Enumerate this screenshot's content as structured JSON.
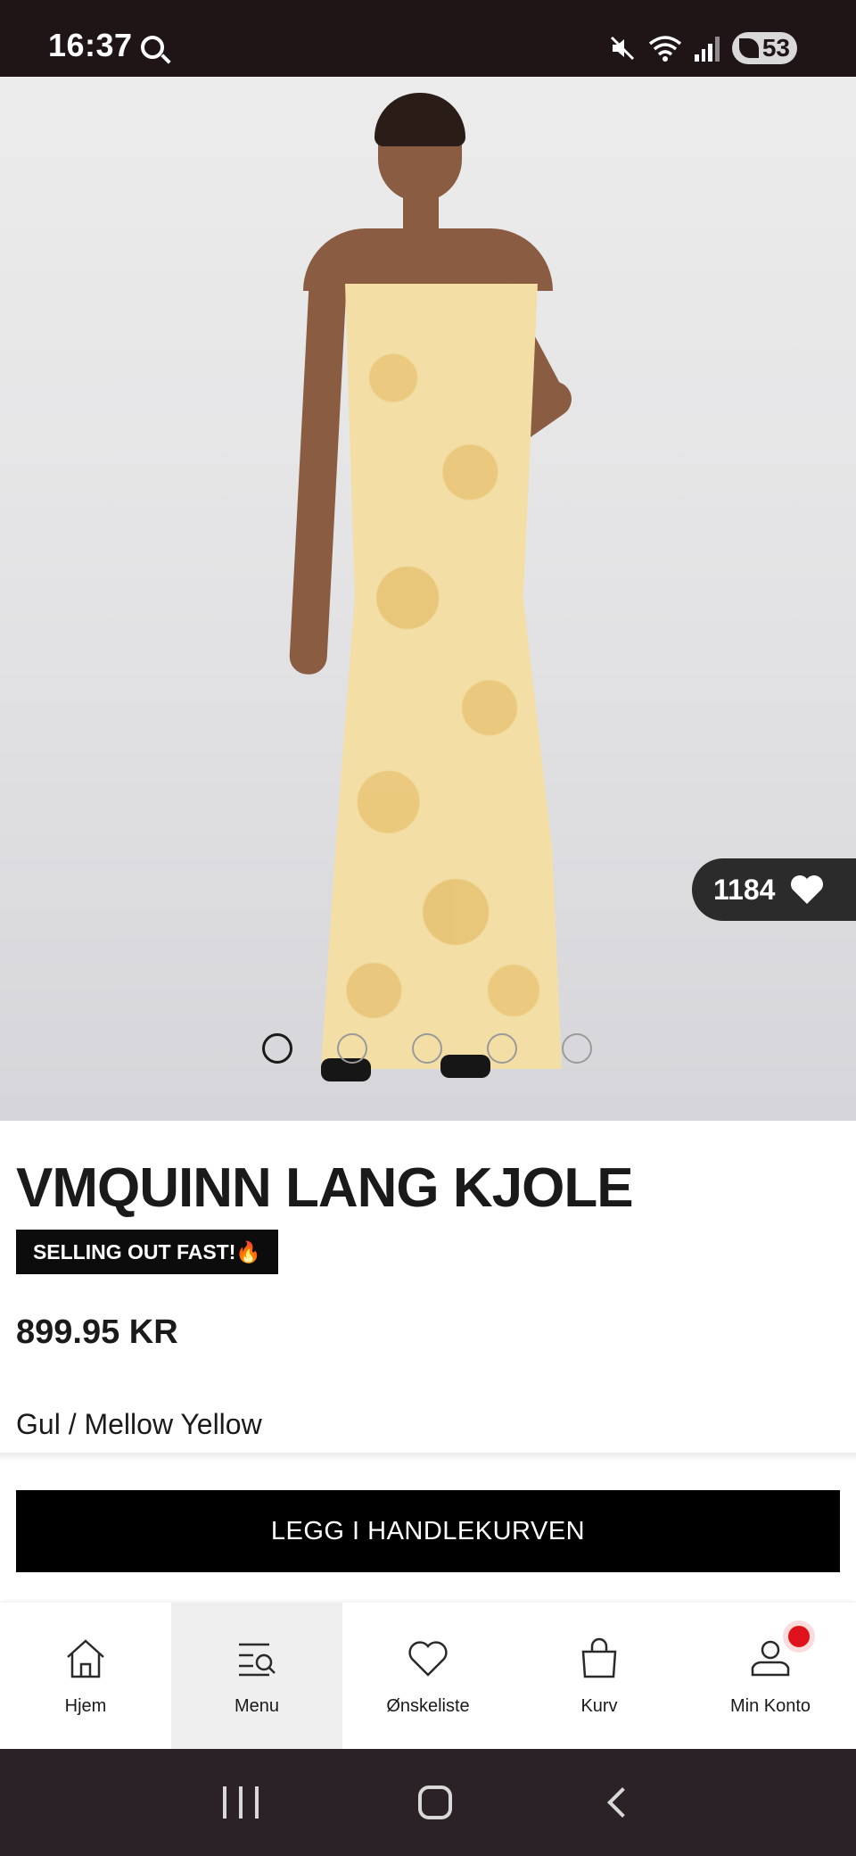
{
  "status_bar": {
    "time": "16:37",
    "battery": "53",
    "icons": [
      "search-icon",
      "mute-icon",
      "wifi-icon",
      "signal-icon",
      "battery-icon"
    ]
  },
  "product": {
    "like_count": "1184",
    "gallery_image_count": 5,
    "gallery_active_index": 1,
    "title": "VMQUINN LANG KJOLE",
    "badge": "SELLING OUT FAST!🔥",
    "price": "899.95 KR",
    "color": "Gul / Mellow Yellow",
    "add_to_cart": "LEGG I HANDLEKURVEN"
  },
  "bottom_nav": {
    "items": [
      {
        "label": "Hjem",
        "icon": "home-icon"
      },
      {
        "label": "Menu",
        "icon": "menu-search-icon"
      },
      {
        "label": "Ønskeliste",
        "icon": "heart-icon"
      },
      {
        "label": "Kurv",
        "icon": "bag-icon"
      },
      {
        "label": "Min Konto",
        "icon": "user-icon"
      }
    ],
    "active": "Menu"
  },
  "colors": {
    "status_bar": "#1f1416",
    "cta_background": "#000000",
    "notification": "#e0121b"
  }
}
